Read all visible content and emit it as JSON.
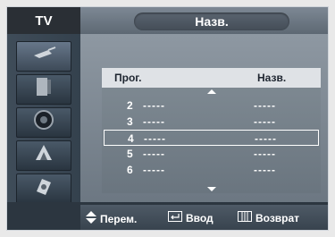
{
  "title_bar": {
    "mode": "TV",
    "title": "Назв."
  },
  "sidebar": {
    "items": [
      {
        "icon": "antenna-icon"
      },
      {
        "icon": "display-icon"
      },
      {
        "icon": "speaker-icon"
      },
      {
        "icon": "satellite-dish-icon"
      },
      {
        "icon": "settings-icon"
      }
    ]
  },
  "table": {
    "col_program": "Прог.",
    "col_name": "Назв.",
    "rows": [
      {
        "num": "2",
        "program": "-----",
        "name": "-----"
      },
      {
        "num": "3",
        "program": "-----",
        "name": "-----"
      },
      {
        "num": "4",
        "program": "-----",
        "name": "-----"
      },
      {
        "num": "5",
        "program": "-----",
        "name": "-----"
      },
      {
        "num": "6",
        "program": "-----",
        "name": "-----"
      }
    ],
    "selected_index": 2
  },
  "footer": {
    "move_label": "Перем.",
    "enter_label": "Ввод",
    "return_label": "Возврат"
  },
  "colors": {
    "accent": "#3c4a58",
    "highlight": "#ffffff"
  }
}
